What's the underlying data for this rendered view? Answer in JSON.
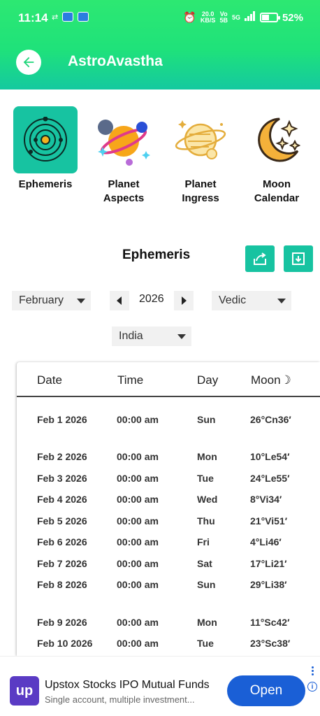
{
  "status": {
    "time": "11:14",
    "speed_top": "20.0",
    "speed_bottom": "KB/S",
    "vo_top": "Vo",
    "vo_bottom": "5B",
    "net": "5G",
    "battery": "52%",
    "battery_level": 0.52
  },
  "appbar": {
    "title": "AstroAvastha"
  },
  "tiles": [
    {
      "label_line1": "Ephemeris",
      "label_line2": ""
    },
    {
      "label_line1": "Planet",
      "label_line2": "Aspects"
    },
    {
      "label_line1": "Planet",
      "label_line2": "Ingress"
    },
    {
      "label_line1": "Moon",
      "label_line2": "Calendar"
    }
  ],
  "section": {
    "title": "Ephemeris"
  },
  "filters": {
    "month": "February",
    "year": "2026",
    "system": "Vedic",
    "country": "India"
  },
  "table": {
    "headers": [
      "Date",
      "Time",
      "Day",
      "Moon☽"
    ],
    "rows": [
      {
        "date": "Feb 1 2026",
        "time": "00:00 am",
        "day": "Sun",
        "moon": "26°Cn36′"
      },
      {
        "date": "Feb 2 2026",
        "time": "00:00 am",
        "day": "Mon",
        "moon": "10°Le54′"
      },
      {
        "date": "Feb 3 2026",
        "time": "00:00 am",
        "day": "Tue",
        "moon": "24°Le55′"
      },
      {
        "date": "Feb 4 2026",
        "time": "00:00 am",
        "day": "Wed",
        "moon": "8°Vi34′"
      },
      {
        "date": "Feb 5 2026",
        "time": "00:00 am",
        "day": "Thu",
        "moon": "21°Vi51′"
      },
      {
        "date": "Feb 6 2026",
        "time": "00:00 am",
        "day": "Fri",
        "moon": "4°Li46′"
      },
      {
        "date": "Feb 7 2026",
        "time": "00:00 am",
        "day": "Sat",
        "moon": "17°Li21′"
      },
      {
        "date": "Feb 8 2026",
        "time": "00:00 am",
        "day": "Sun",
        "moon": "29°Li38′"
      },
      {
        "date": "Feb 9 2026",
        "time": "00:00 am",
        "day": "Mon",
        "moon": "11°Sc42′"
      },
      {
        "date": "Feb 10 2026",
        "time": "00:00 am",
        "day": "Tue",
        "moon": "23°Sc38′"
      }
    ]
  },
  "ad": {
    "logo": "up",
    "title": "Upstox Stocks IPO Mutual Funds",
    "subtitle": "Single account, multiple investment...",
    "button": "Open",
    "info": "i"
  },
  "colors": {
    "accent": "#17c3a1",
    "header_top": "#2de872",
    "ad_button": "#1a5fd6"
  }
}
